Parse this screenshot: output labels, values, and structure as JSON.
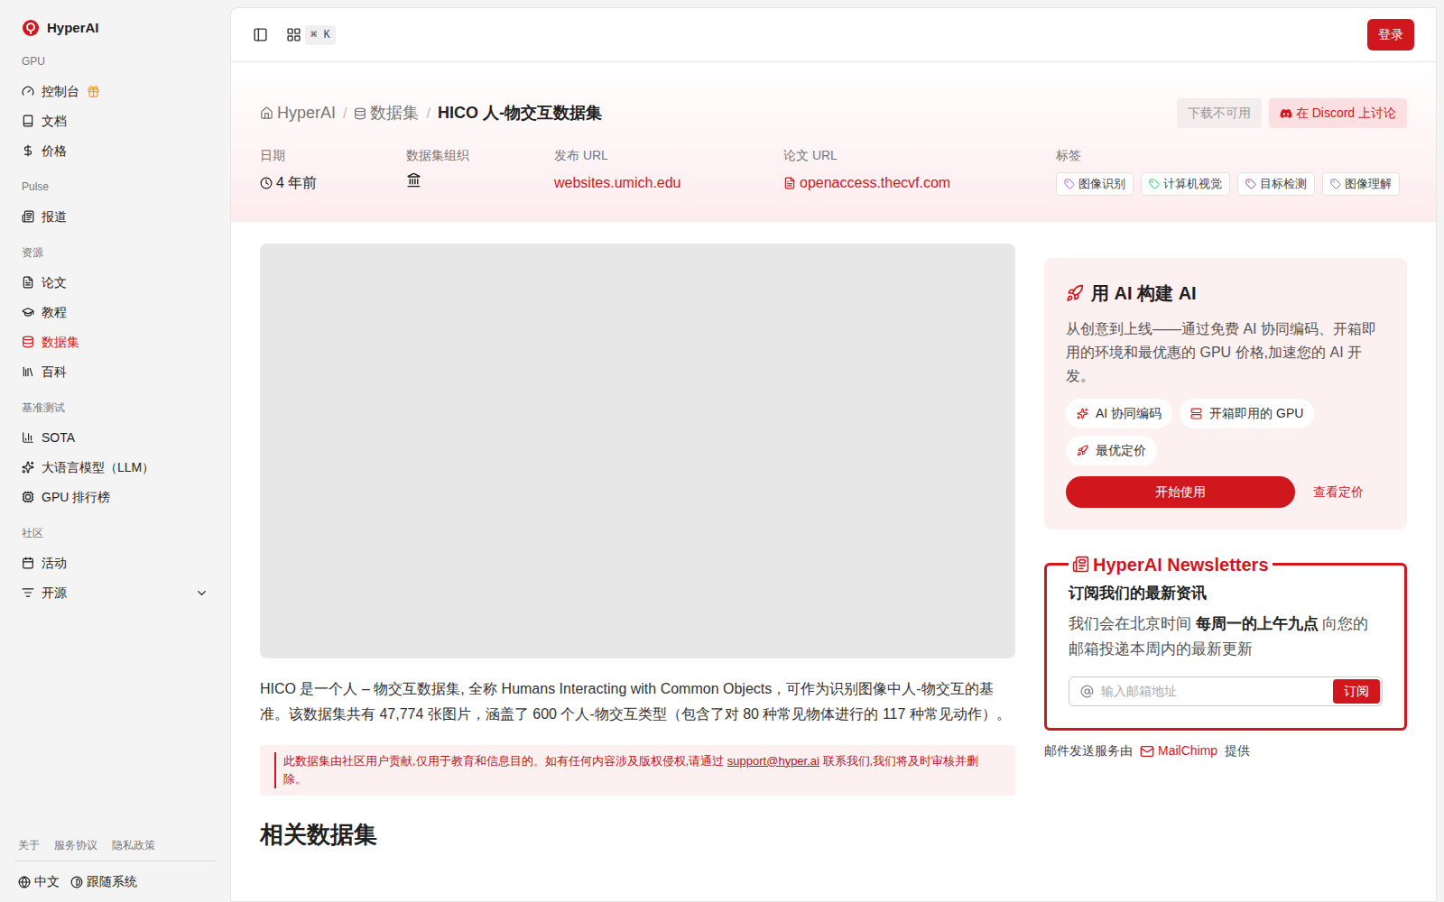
{
  "brand": "HyperAI",
  "sidebar": {
    "sections": [
      {
        "title": "GPU",
        "items": [
          {
            "label": "控制台",
            "selected": false,
            "badge": true,
            "expandable": false
          },
          {
            "label": "文档",
            "selected": false,
            "badge": false,
            "expandable": false
          },
          {
            "label": "价格",
            "selected": false,
            "badge": false,
            "expandable": false
          }
        ]
      },
      {
        "title": "Pulse",
        "items": [
          {
            "label": "报道",
            "selected": false,
            "badge": false,
            "expandable": false
          }
        ]
      },
      {
        "title": "资源",
        "items": [
          {
            "label": "论文",
            "selected": false,
            "badge": false,
            "expandable": false
          },
          {
            "label": "教程",
            "selected": false,
            "badge": false,
            "expandable": false
          },
          {
            "label": "数据集",
            "selected": true,
            "badge": false,
            "expandable": false
          },
          {
            "label": "百科",
            "selected": false,
            "badge": false,
            "expandable": false
          }
        ]
      },
      {
        "title": "基准测试",
        "items": [
          {
            "label": "SOTA",
            "selected": false,
            "badge": false,
            "expandable": false
          },
          {
            "label": "大语言模型（LLM）",
            "selected": false,
            "badge": false,
            "expandable": false
          },
          {
            "label": "GPU 排行榜",
            "selected": false,
            "badge": false,
            "expandable": false
          }
        ]
      },
      {
        "title": "社区",
        "items": [
          {
            "label": "活动",
            "selected": false,
            "badge": false,
            "expandable": false
          },
          {
            "label": "开源",
            "selected": false,
            "badge": false,
            "expandable": true
          }
        ]
      }
    ],
    "footer_links": [
      "关于",
      "服务协议",
      "隐私政策"
    ],
    "language": "中文",
    "theme": "跟随系统"
  },
  "topbar": {
    "shortcut": "⌘ K",
    "login": "登录"
  },
  "breadcrumb": [
    "HyperAI",
    "数据集",
    "HICO 人-物交互数据集"
  ],
  "actions": [
    {
      "label": "下载不可用",
      "disabled": true
    },
    {
      "label": "在 Discord 上讨论",
      "disabled": false
    }
  ],
  "meta": {
    "date_label": "日期",
    "date": "4 年前",
    "org_label": "数据集组织",
    "release_label": "发布 URL",
    "release_url": "websites.umich.edu",
    "paper_label": "论文 URL",
    "paper_url": "openaccess.thecvf.com",
    "tags_label": "标签"
  },
  "tags": [
    {
      "label": "图像识别",
      "color": "#a855f7"
    },
    {
      "label": "计算机视觉",
      "color": "#22c55e"
    },
    {
      "label": "目标检测",
      "color": "#db2777"
    },
    {
      "label": "图像理解",
      "color": "#a855f7"
    }
  ],
  "description": "HICO 是一个人 – 物交互数据集, 全称 Humans Interacting with Common Objects，可作为识别图像中人-物交互的基准。该数据集共有 47,774 张图片，涵盖了 600 个人-物交互类型（包含了对 80 种常见物体进行的 117 种常见动作）。",
  "notice": {
    "before": "此数据集由社区用户贡献,仅用于教育和信息目的。如有任何内容涉及版权侵权,请通过 ",
    "link": "support@hyper.ai",
    "after": " 联系我们,我们将及时审核并删除。"
  },
  "related_heading": "相关数据集",
  "promo": {
    "title": "用 AI 构建 AI",
    "text": "从创意到上线——通过免费 AI 协同编码、开箱即用的环境和最优惠的 GPU 价格,加速您的 AI 开发。",
    "features": [
      "AI 协同编码",
      "开箱即用的 GPU",
      "最优定价"
    ],
    "primary": "开始使用",
    "secondary": "查看定价"
  },
  "newsletter": {
    "title": "HyperAI Newsletters",
    "heading": "订阅我们的最新资讯",
    "text_before": "我们会在北京时间 ",
    "text_bold": "每周一的上午九点",
    "text_after": " 向您的邮箱投递本周内的最新更新",
    "placeholder": "输入邮箱地址",
    "button": "订阅"
  },
  "mail_footer": {
    "before": "邮件发送服务由",
    "brand": "MailChimp",
    "after": "提供"
  }
}
